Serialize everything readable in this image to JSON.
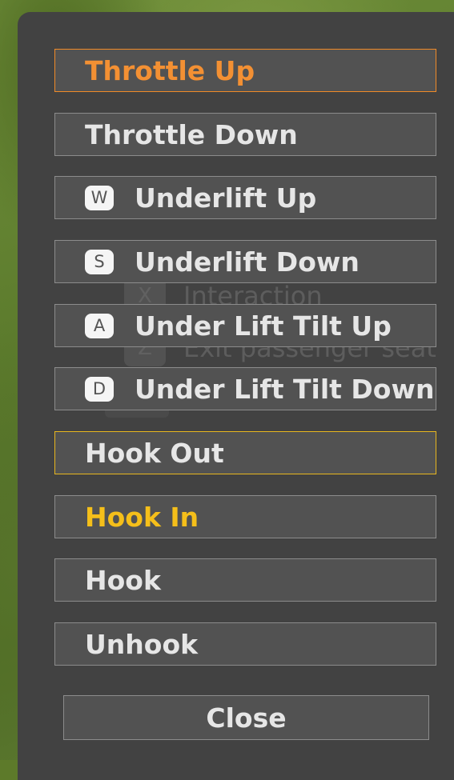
{
  "colors": {
    "panel": "#424242",
    "button_bg": "#525252",
    "button_border": "#8c8c8c",
    "text": "#e6e6e6",
    "selected": "#f39033",
    "highlight": "#f5bf1a",
    "key_badge": "#f5f5f5"
  },
  "background_hud": {
    "items": [
      {
        "key": "X",
        "label": "Interaction"
      },
      {
        "key": "Z",
        "label": "Exit passenger seat"
      }
    ]
  },
  "menu": {
    "items": [
      {
        "label": "Throttle Up",
        "key": "",
        "state": "selected"
      },
      {
        "label": "Throttle Down",
        "key": "",
        "state": "normal"
      },
      {
        "label": "Underlift Up",
        "key": "W",
        "state": "normal"
      },
      {
        "label": "Underlift Down",
        "key": "S",
        "state": "normal"
      },
      {
        "label": "Under Lift Tilt Up",
        "key": "A",
        "state": "normal"
      },
      {
        "label": "Under Lift Tilt Down",
        "key": "D",
        "state": "normal"
      },
      {
        "label": "Hook Out",
        "key": "",
        "state": "outlined"
      },
      {
        "label": "Hook In",
        "key": "",
        "state": "highlighted"
      },
      {
        "label": "Hook",
        "key": "",
        "state": "normal"
      },
      {
        "label": "Unhook",
        "key": "",
        "state": "normal"
      }
    ]
  },
  "close": {
    "label": "Close"
  }
}
